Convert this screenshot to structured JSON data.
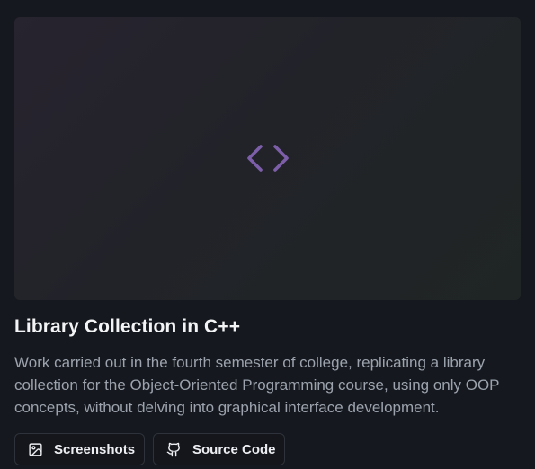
{
  "project": {
    "title": "Library Collection in C++",
    "description": "Work carried out in the fourth semester of college, replicating a library collection for the Object-Oriented Programming course, using only OOP concepts, without delving into graphical interface development.",
    "preview_icon": "code-icon"
  },
  "buttons": {
    "screenshots": {
      "label": "Screenshots",
      "icon": "image-icon"
    },
    "source_code": {
      "label": "Source Code",
      "icon": "github-icon"
    }
  },
  "colors": {
    "background": "#15181e",
    "accent": "#7c5fa8",
    "title": "#f3f4f6",
    "description": "#9ca3ad",
    "button_border": "#2e323b"
  }
}
